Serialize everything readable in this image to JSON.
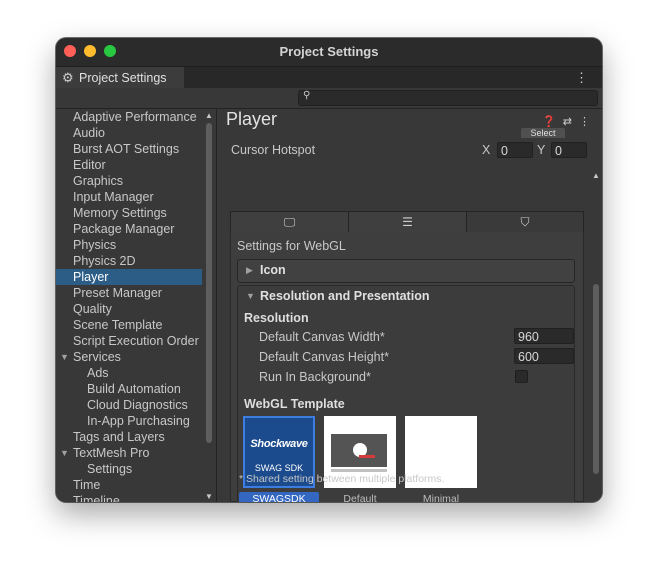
{
  "window": {
    "title": "Project Settings",
    "tab_label": "Project Settings",
    "tab_icon": "gear-icon",
    "menu_icon": "⋮",
    "search_icon": "🔍"
  },
  "sidebar": {
    "items": [
      {
        "label": "Adaptive Performance"
      },
      {
        "label": "Audio"
      },
      {
        "label": "Burst AOT Settings"
      },
      {
        "label": "Editor"
      },
      {
        "label": "Graphics"
      },
      {
        "label": "Input Manager"
      },
      {
        "label": "Memory Settings"
      },
      {
        "label": "Package Manager"
      },
      {
        "label": "Physics"
      },
      {
        "label": "Physics 2D"
      },
      {
        "label": "Player",
        "selected": true
      },
      {
        "label": "Preset Manager"
      },
      {
        "label": "Quality"
      },
      {
        "label": "Scene Template"
      },
      {
        "label": "Script Execution Order"
      },
      {
        "label": "Services",
        "expanded": true
      },
      {
        "label": "Ads",
        "child": true
      },
      {
        "label": "Build Automation",
        "child": true
      },
      {
        "label": "Cloud Diagnostics",
        "child": true
      },
      {
        "label": "In-App Purchasing",
        "child": true
      },
      {
        "label": "Tags and Layers"
      },
      {
        "label": "TextMesh Pro",
        "expanded": true
      },
      {
        "label": "Settings",
        "child": true
      },
      {
        "label": "Time"
      },
      {
        "label": "Timeline"
      }
    ]
  },
  "main": {
    "title": "Player",
    "select_label": "Select",
    "cursor_hotspot": {
      "label": "Cursor Hotspot",
      "x_label": "X",
      "x_value": "0",
      "y_label": "Y",
      "y_value": "0"
    },
    "platform_tabs": [
      {
        "icon": "monitor-icon",
        "active": false
      },
      {
        "icon": "server-icon",
        "active": false
      },
      {
        "icon": "html5-icon",
        "active": true
      }
    ],
    "settings_for": "Settings for WebGL",
    "icon_section": "Icon",
    "res_section": "Resolution and Presentation",
    "resolution_heading": "Resolution",
    "canvas_width": {
      "label": "Default Canvas Width*",
      "value": "960"
    },
    "canvas_height": {
      "label": "Default Canvas Height*",
      "value": "600"
    },
    "run_in_background": {
      "label": "Run In Background*",
      "checked": false
    },
    "template_heading": "WebGL Template",
    "templates": [
      {
        "label": "SWAGSDK",
        "logo_text": "Shockwave",
        "caption": "SWAG SDK",
        "selected": true
      },
      {
        "label": "Default",
        "selected": false
      },
      {
        "label": "Minimal",
        "selected": false
      }
    ],
    "footnote": "* Shared setting between multiple platforms."
  },
  "colors": {
    "accent": "#2c5d87",
    "template_selected": "#3367c2"
  }
}
